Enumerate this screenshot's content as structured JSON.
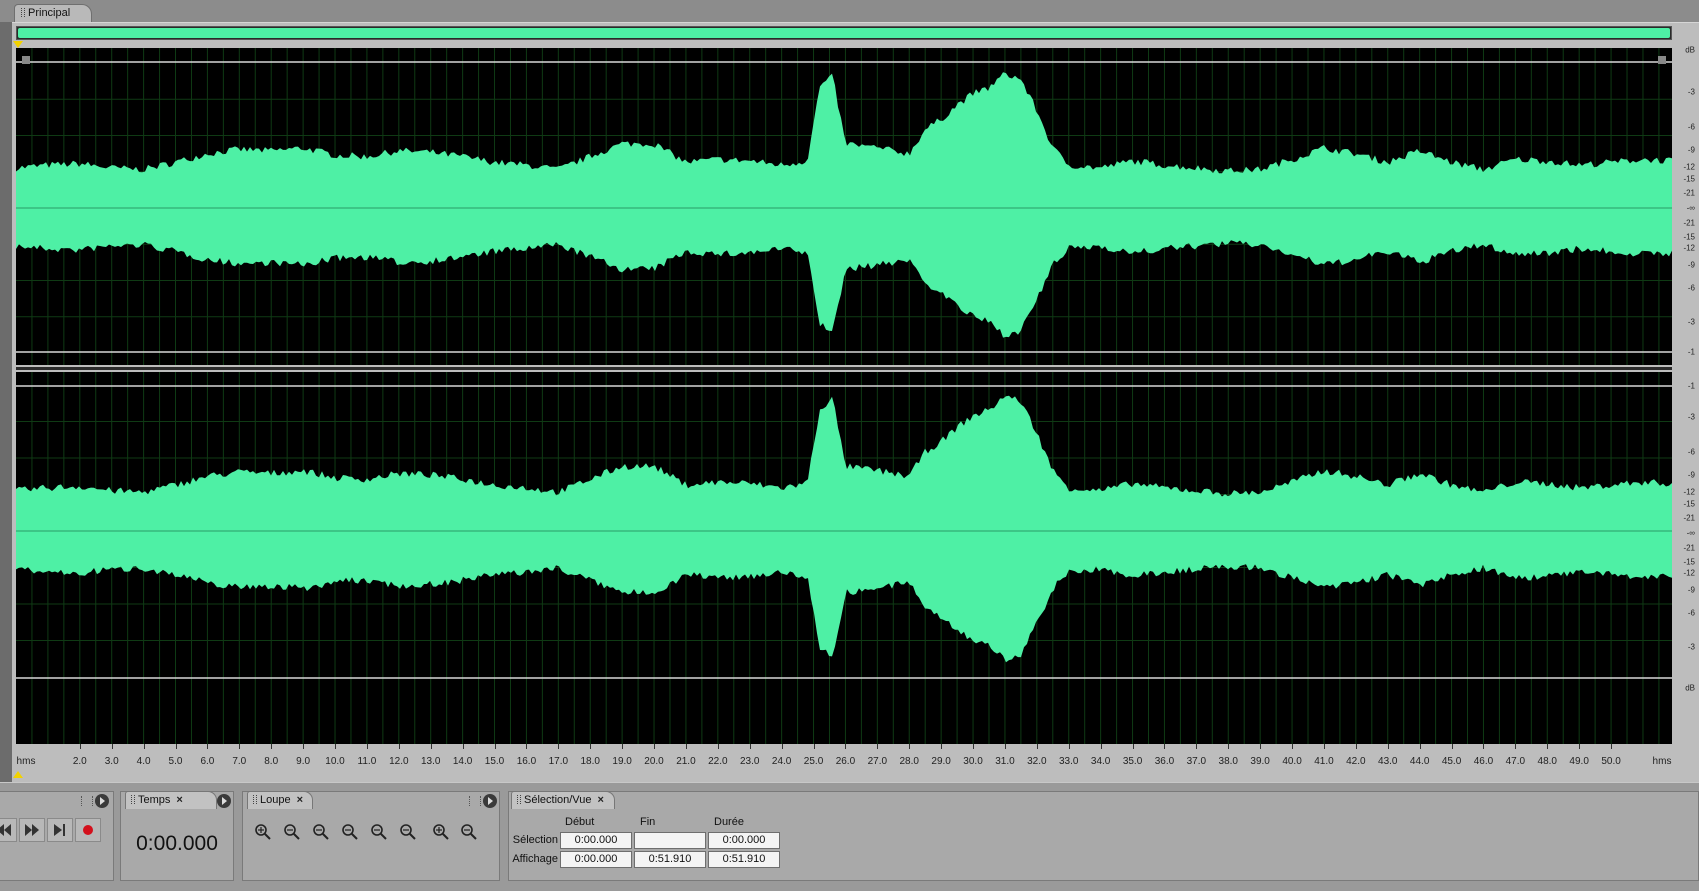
{
  "tabs": {
    "main": "Principal"
  },
  "colors": {
    "waveform": "#4ef0a5",
    "background": "#000000",
    "grid": "#0f3a14",
    "playhead": "#f2d200"
  },
  "db_scale": {
    "unit": "dB",
    "channel1_labels": [
      "-3",
      "-6",
      "-9",
      "-12",
      "-15",
      "-21",
      "-∞",
      "-21",
      "-15",
      "-12",
      "-9",
      "-6",
      "-3",
      "-1"
    ],
    "channel2_labels": [
      "-1",
      "-3",
      "-6",
      "-9",
      "-12",
      "-15",
      "-21",
      "-∞",
      "-21",
      "-15",
      "-12",
      "-9",
      "-6",
      "-3"
    ]
  },
  "time_ruler": {
    "unit_label": "hms",
    "labels": [
      "2.0",
      "3.0",
      "4.0",
      "5.0",
      "6.0",
      "7.0",
      "8.0",
      "9.0",
      "10.0",
      "11.0",
      "12.0",
      "13.0",
      "14.0",
      "15.0",
      "16.0",
      "17.0",
      "18.0",
      "19.0",
      "20.0",
      "21.0",
      "22.0",
      "23.0",
      "24.0",
      "25.0",
      "26.0",
      "27.0",
      "28.0",
      "29.0",
      "30.0",
      "31.0",
      "32.0",
      "33.0",
      "34.0",
      "35.0",
      "36.0",
      "37.0",
      "38.0",
      "39.0",
      "40.0",
      "41.0",
      "42.0",
      "43.0",
      "44.0",
      "45.0",
      "46.0",
      "47.0",
      "48.0",
      "49.0",
      "50.0"
    ],
    "start_seconds": 0,
    "end_seconds": 51.91
  },
  "transport": {
    "buttons": [
      "rewind-icon",
      "fast-forward-icon",
      "skip-to-end-icon",
      "record-icon"
    ]
  },
  "time_panel": {
    "title": "Temps",
    "value": "0:00.000"
  },
  "zoom_panel": {
    "title": "Loupe",
    "buttons": [
      "zoom-in-amplitude",
      "zoom-out-amplitude",
      "zoom-out-full",
      "zoom-selection",
      "zoom-left-edge",
      "zoom-right-edge",
      "zoom-in-vertical",
      "zoom-out-vertical"
    ]
  },
  "selection_panel": {
    "title": "Sélection/Vue",
    "headers": {
      "start": "Début",
      "end": "Fin",
      "duration": "Durée"
    },
    "selection": {
      "label": "Sélection",
      "start": "0:00.000",
      "end": "",
      "duration": "0:00.000"
    },
    "view": {
      "label": "Affichage",
      "start": "0:00.000",
      "end": "0:51.910",
      "duration": "0:51.910"
    }
  }
}
